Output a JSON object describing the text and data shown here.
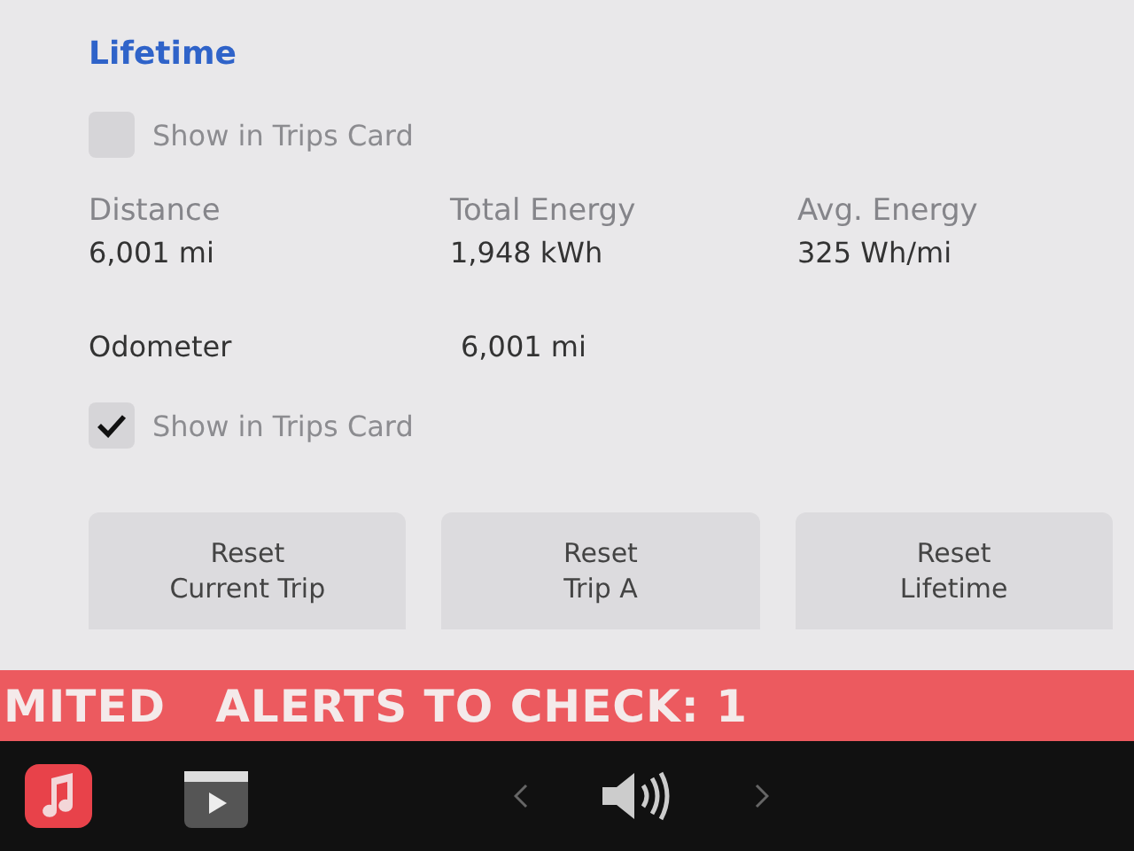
{
  "section": {
    "title": "Lifetime"
  },
  "trips_toggle_top": {
    "label": "Show in Trips Card",
    "checked": false
  },
  "stats": [
    {
      "label": "Distance",
      "value": "6,001 mi"
    },
    {
      "label": "Total Energy",
      "value": "1,948 kWh"
    },
    {
      "label": "Avg. Energy",
      "value": "325 Wh/mi"
    }
  ],
  "odometer": {
    "label": "Odometer",
    "value": "6,001 mi"
  },
  "trips_toggle_bottom": {
    "label": "Show in Trips Card",
    "checked": true
  },
  "buttons": [
    "Reset\nCurrent Trip",
    "Reset\nTrip A",
    "Reset\nLifetime"
  ],
  "alert_banner": [
    "MITED",
    "ALERTS TO CHECK: 1"
  ],
  "taskbar": [
    {
      "kind": "music"
    },
    {
      "kind": "video"
    },
    {
      "kind": "prev"
    },
    {
      "kind": "volume"
    },
    {
      "kind": "next"
    }
  ]
}
